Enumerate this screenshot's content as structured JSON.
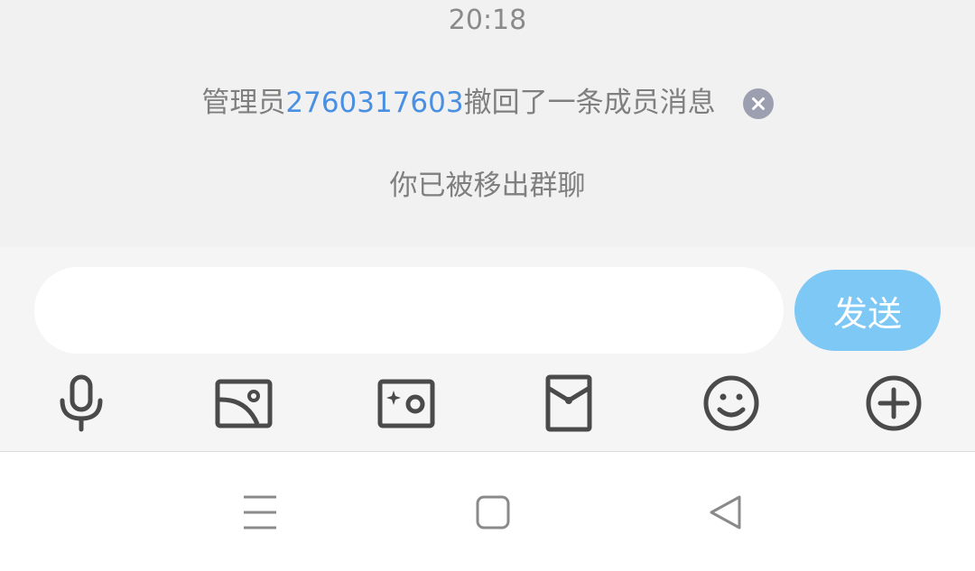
{
  "chat": {
    "timestamp": "20:18",
    "recall_notice": {
      "prefix": "管理员",
      "admin_id": "2760317603",
      "suffix": "撤回了一条成员消息"
    },
    "removed_notice": "你已被移出群聊"
  },
  "input": {
    "value": "",
    "placeholder": "",
    "send_label": "发送"
  },
  "toolbar": {
    "items": [
      {
        "icon": "microphone-icon"
      },
      {
        "icon": "image-icon"
      },
      {
        "icon": "camera-icon"
      },
      {
        "icon": "red-packet-icon"
      },
      {
        "icon": "emoji-icon"
      },
      {
        "icon": "plus-icon"
      }
    ]
  },
  "nav": {
    "items": [
      {
        "icon": "menu-icon"
      },
      {
        "icon": "home-icon"
      },
      {
        "icon": "back-icon"
      }
    ]
  },
  "colors": {
    "admin_id": "#4a90e2",
    "send_button": "#7ec8f5",
    "icon": "#4a4a4a"
  }
}
